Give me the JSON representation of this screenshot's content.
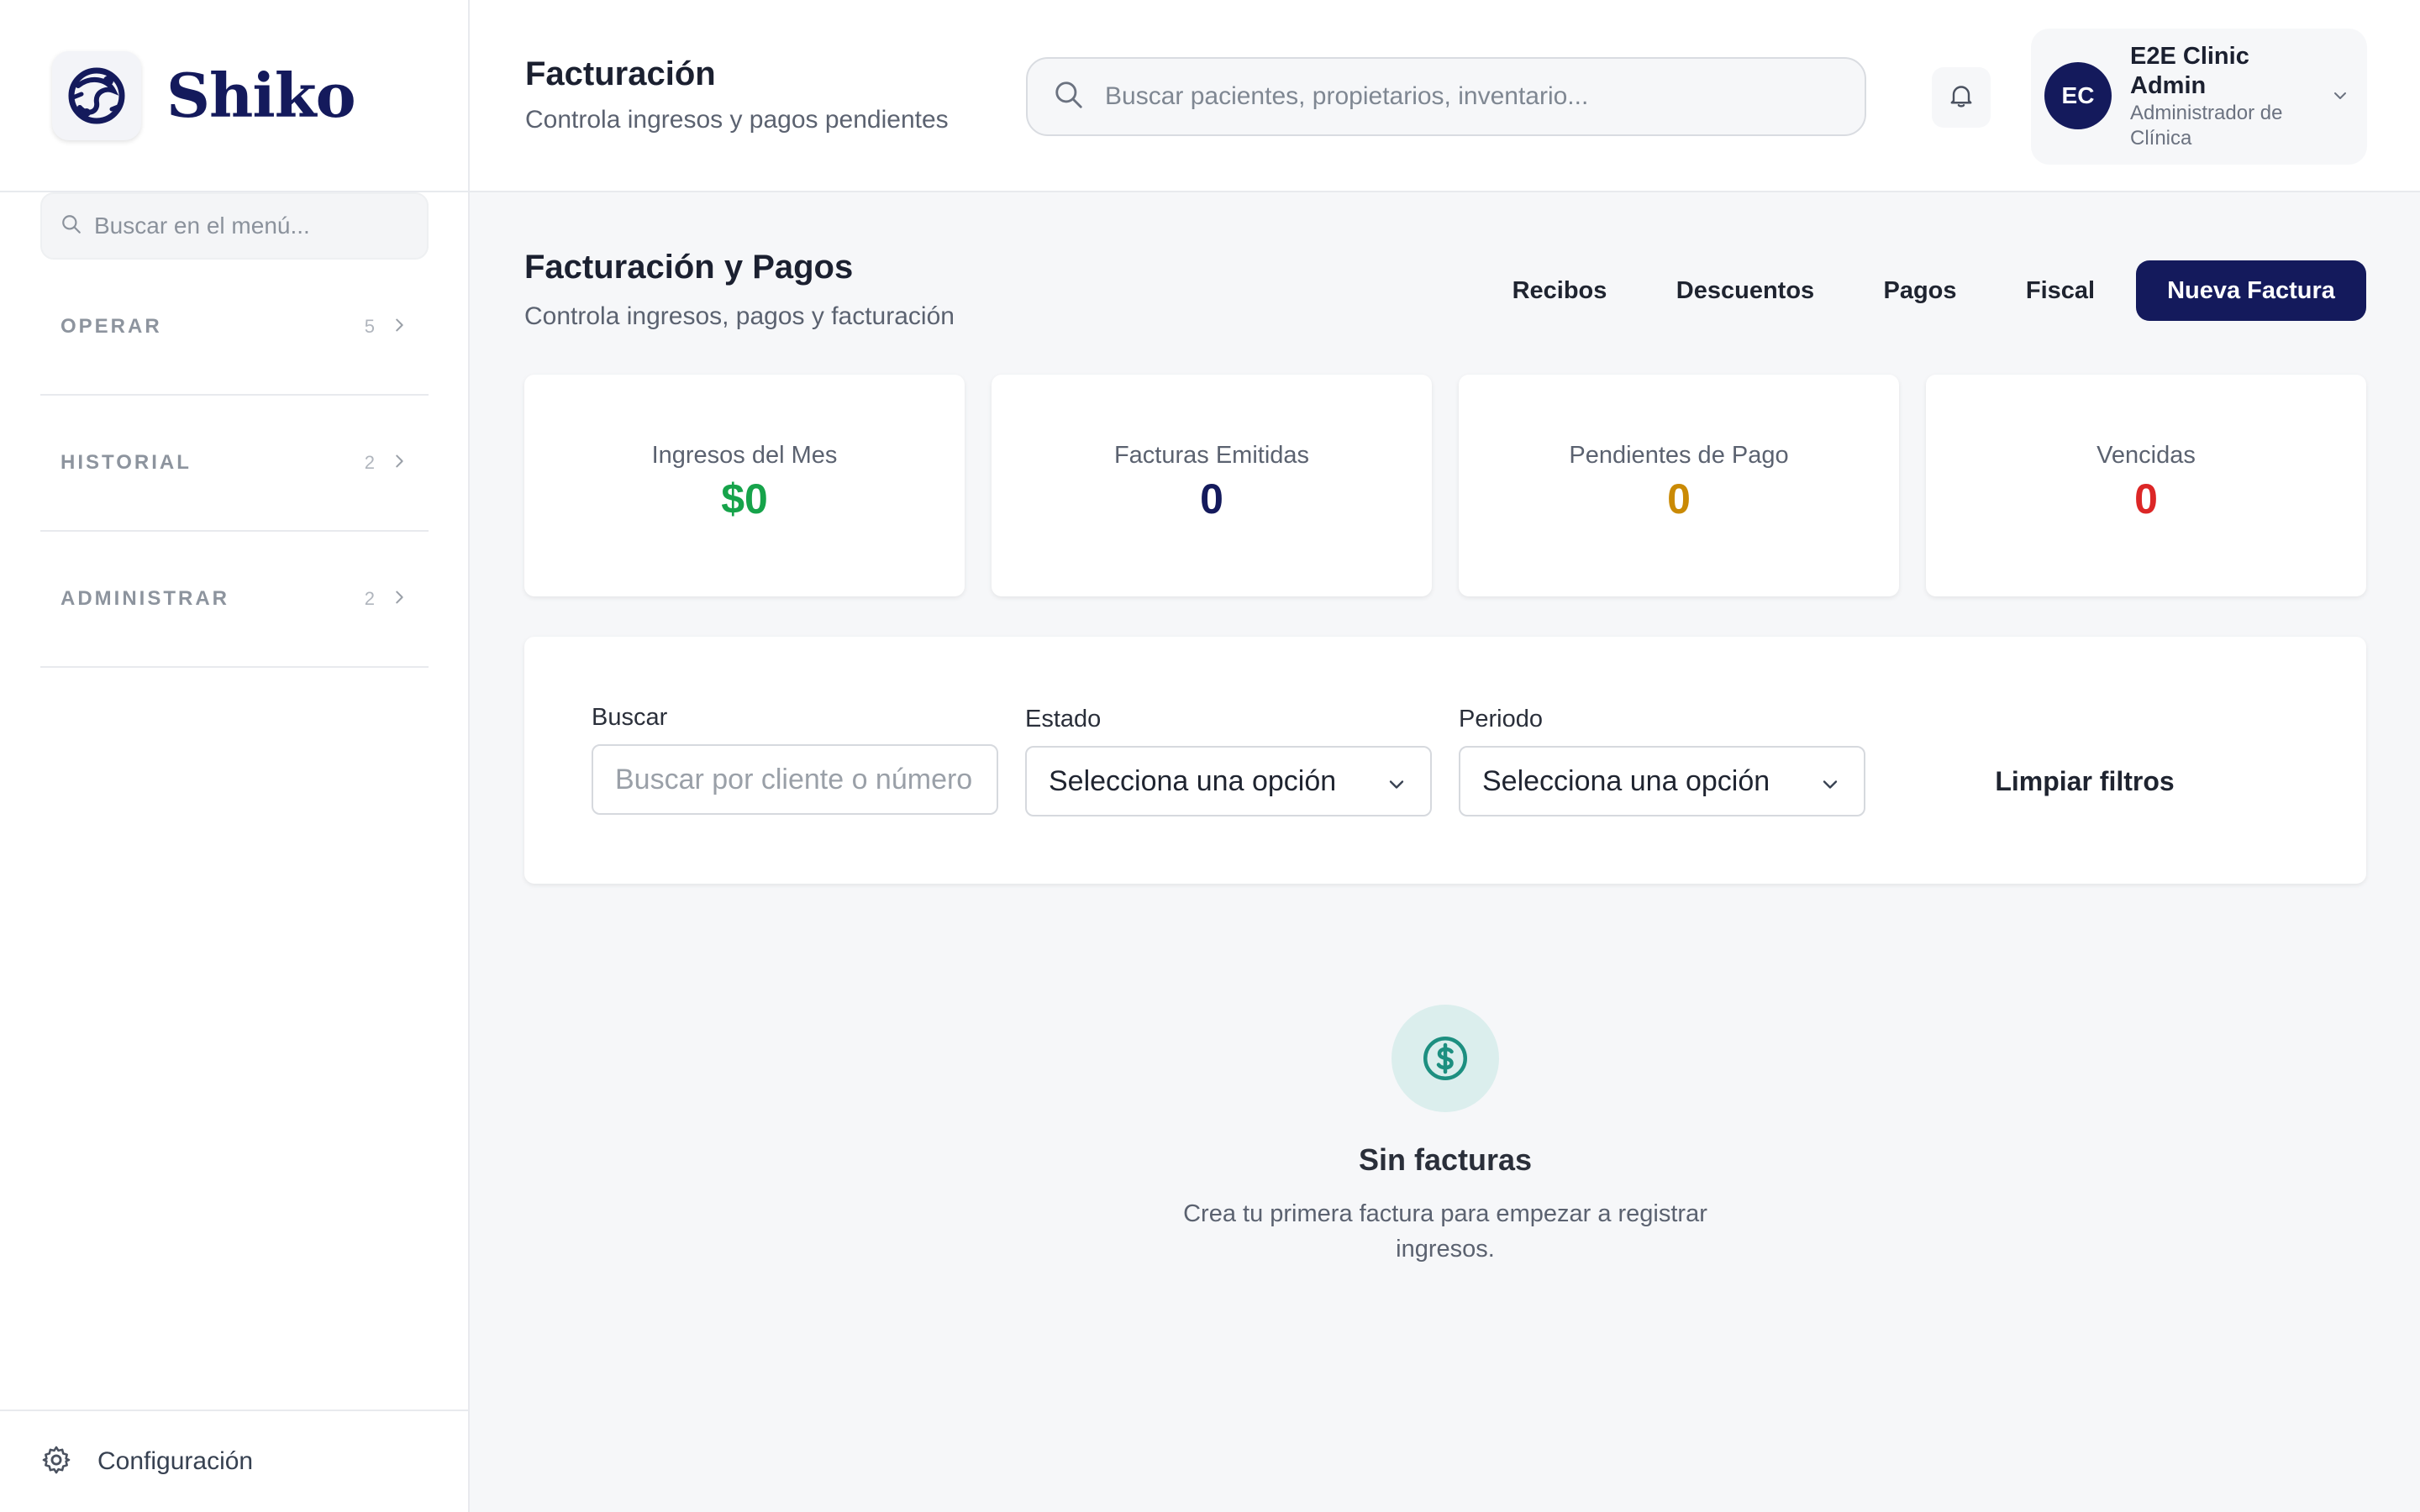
{
  "brand": {
    "name": "Shiko"
  },
  "sidebar": {
    "search_placeholder": "Buscar en el menú...",
    "sections": [
      {
        "label": "OPERAR",
        "count": "5"
      },
      {
        "label": "HISTORIAL",
        "count": "2"
      },
      {
        "label": "ADMINISTRAR",
        "count": "2"
      }
    ],
    "config_label": "Configuración"
  },
  "header": {
    "title": "Facturación",
    "subtitle": "Controla ingresos y pagos pendientes",
    "search_placeholder": "Buscar pacientes, propietarios, inventario...",
    "user": {
      "initials": "EC",
      "name": "E2E Clinic Admin",
      "role": "Administrador de Clínica"
    }
  },
  "main": {
    "title": "Facturación y Pagos",
    "subtitle": "Controla ingresos, pagos y facturación",
    "tabs": [
      "Recibos",
      "Descuentos",
      "Pagos",
      "Fiscal"
    ],
    "primary_action": "Nueva Factura",
    "stats": [
      {
        "label": "Ingresos del Mes",
        "value": "$0",
        "color": "#16a34a"
      },
      {
        "label": "Facturas Emitidas",
        "value": "0",
        "color": "#141a5c"
      },
      {
        "label": "Pendientes de Pago",
        "value": "0",
        "color": "#ca8a04"
      },
      {
        "label": "Vencidas",
        "value": "0",
        "color": "#dc2626"
      }
    ],
    "filters": {
      "search_label": "Buscar",
      "search_placeholder": "Buscar por cliente o número",
      "status_label": "Estado",
      "status_value": "Selecciona una opción",
      "period_label": "Periodo",
      "period_value": "Selecciona una opción",
      "clear_label": "Limpiar filtros"
    },
    "empty": {
      "title": "Sin facturas",
      "message": "Crea tu primera factura para empezar a registrar ingresos."
    }
  },
  "colors": {
    "brand": "#141a5c",
    "empty_icon": "#1d8f80",
    "empty_icon_bg": "#dbeeed"
  }
}
